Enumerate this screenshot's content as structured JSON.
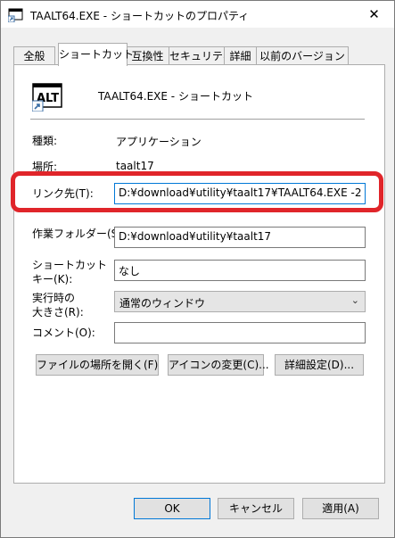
{
  "window": {
    "title": "TAALT64.EXE - ショートカットのプロパティ",
    "close_label": "✕",
    "accent_color": "#0078d7",
    "highlight_color": "#e0252a"
  },
  "tabs": [
    {
      "label": "全般",
      "active": false
    },
    {
      "label": "ショートカット",
      "active": true
    },
    {
      "label": "互換性",
      "active": false
    },
    {
      "label": "セキュリティ",
      "active": false
    },
    {
      "label": "詳細",
      "active": false
    },
    {
      "label": "以前のバージョン",
      "active": false
    }
  ],
  "header": {
    "icon_text": "ALT",
    "name": "TAALT64.EXE - ショートカット"
  },
  "info": {
    "type_label": "種類:",
    "type_value": "アプリケーション",
    "location_label": "場所:",
    "location_value": "taalt17"
  },
  "fields": {
    "target_label": "リンク先(T):",
    "target_value": "D:¥download¥utility¥taalt17¥TAALT64.EXE -2",
    "startin_label": "作業フォルダー(S):",
    "startin_value": "D:¥download¥utility¥taalt17",
    "hotkey_label_line1": "ショートカット",
    "hotkey_label_line2": "キー(K):",
    "hotkey_value": "なし",
    "run_label_line1": "実行時の",
    "run_label_line2": "大きさ(R):",
    "run_value": "通常のウィンドウ",
    "comment_label": "コメント(O):",
    "comment_value": ""
  },
  "actions": {
    "open_location": "ファイルの場所を開く(F)",
    "change_icon": "アイコンの変更(C)...",
    "advanced": "詳細設定(D)..."
  },
  "footer": {
    "ok": "OK",
    "cancel": "キャンセル",
    "apply": "適用(A)"
  }
}
